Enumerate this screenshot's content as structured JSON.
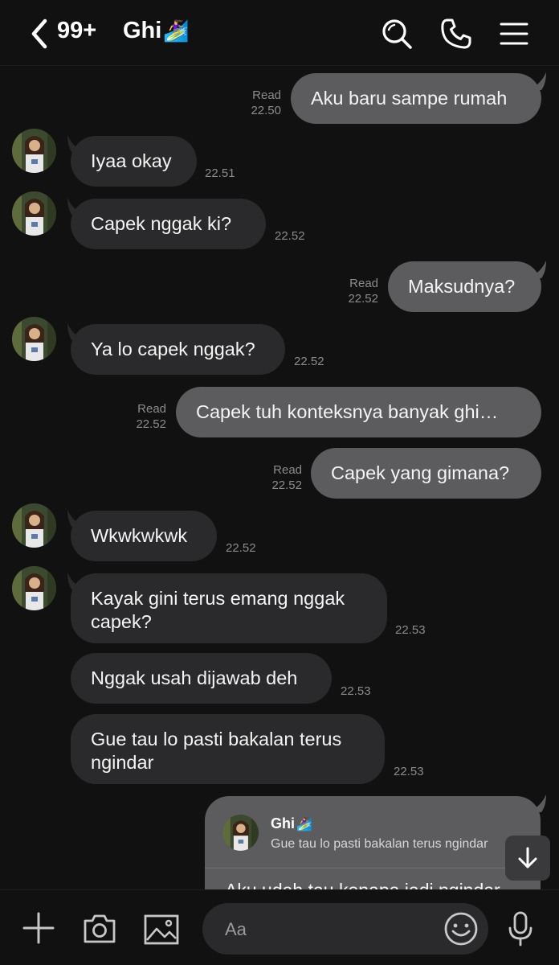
{
  "header": {
    "unread_count": "99+",
    "contact_name": "Ghi",
    "contact_emoji": "🏄‍♀️"
  },
  "messages": [
    {
      "dir": "out",
      "text": "Aku baru sampe rumah",
      "read": "Read",
      "time": "22.50"
    },
    {
      "dir": "in",
      "text": "Iyaa okay",
      "time": "22.51"
    },
    {
      "dir": "in",
      "text": "Capek nggak ki?",
      "time": "22.52"
    },
    {
      "dir": "out",
      "text": "Maksudnya?",
      "read": "Read",
      "time": "22.52"
    },
    {
      "dir": "in",
      "text": "Ya lo capek nggak?",
      "time": "22.52"
    },
    {
      "dir": "out",
      "text": "Capek tuh konteksnya banyak ghi…",
      "read": "Read",
      "time": "22.52"
    },
    {
      "dir": "out",
      "text": "Capek yang gimana?",
      "read": "Read",
      "time": "22.52"
    },
    {
      "dir": "in",
      "text": "Wkwkwkwk",
      "time": "22.52"
    },
    {
      "dir": "in",
      "text": "Kayak gini terus emang nggak\ncapek?",
      "time": "22.53"
    },
    {
      "dir": "in",
      "text": "Nggak usah dijawab deh",
      "time": "22.53"
    },
    {
      "dir": "in",
      "text": "Gue tau lo pasti bakalan terus\nngindar",
      "time": "22.53"
    }
  ],
  "reply": {
    "name": "Ghi",
    "emoji": "🏄‍♀️",
    "quoted": "Gue tau lo pasti bakalan terus ngindar",
    "body_partial": "Aku udah tau kenapa jadi ngindar"
  },
  "composer": {
    "placeholder": "Aa"
  },
  "colors": {
    "background": "#111111",
    "incoming_bubble": "#2a2a2c",
    "outgoing_bubble": "#5c5c5e",
    "timestamp": "#8b8b8b"
  }
}
